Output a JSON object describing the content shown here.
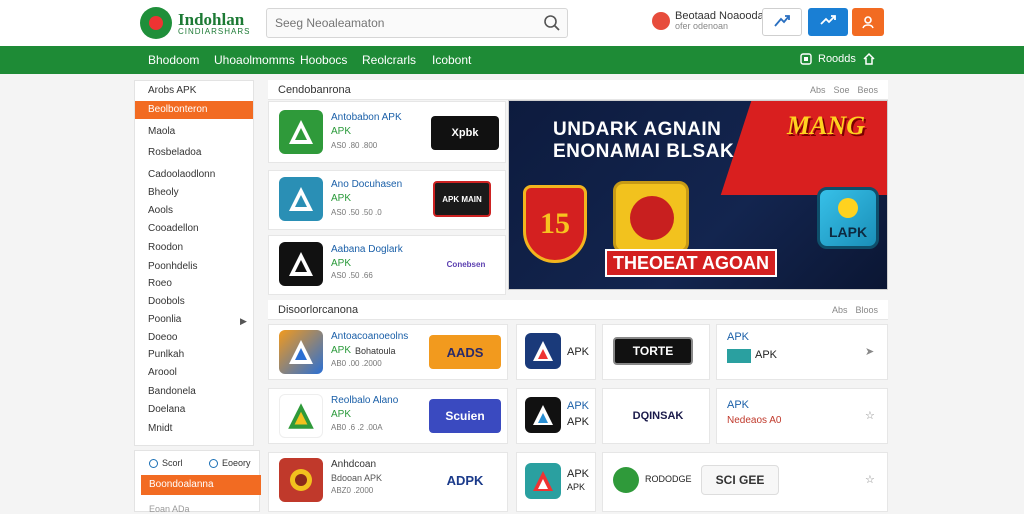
{
  "header": {
    "logo_title": "Indohlan",
    "logo_sub": "CINDIARSHARS",
    "search_placeholder": "Seeg Neoaleamaton",
    "account_name": "Beotaad Noaoodar",
    "account_sub": "ofer odenoan"
  },
  "nav": {
    "items": [
      "Bhodoom",
      "Uhoaolmomms",
      "Hoobocs",
      "Reolcrarls",
      "Icobont"
    ],
    "right_label": "Roodds"
  },
  "sidebar": {
    "items": [
      "Arobs APK",
      "Beolbonteron",
      "Maola",
      "Rosbeladoa",
      "Cadoolaodlonn",
      "Bheoly",
      "Aools",
      "Cooadellon",
      "Roodon",
      "Poonhdelis",
      "Roeo",
      "Doobols",
      "Poonlia",
      "Doeoo",
      "Punlkah",
      "Aroool",
      "Bandonela",
      "Doelana",
      "Mnidt"
    ],
    "active_index": 1,
    "radio_a": "Scorl",
    "radio_b": "Eoeory",
    "cta": "Boondoalanna",
    "footer": "Eoan ADa"
  },
  "section1": {
    "title": "Cendobanrona",
    "tools": [
      "Abs",
      "Soe",
      "Beos"
    ],
    "apps": [
      {
        "name": "Antobabon APK",
        "type": "APK",
        "meta": "AS0 .80 .800",
        "ad": "Xpbk"
      },
      {
        "name": "Ano Docuhasen",
        "type": "APK",
        "meta": "AS0 .50 .50 .0",
        "ad": "APK MAIN"
      },
      {
        "name": "Aabana Doglark",
        "type": "APK",
        "meta": "AS0 .50 .66",
        "ad": "Conebsen"
      }
    ]
  },
  "banner": {
    "headline_1": "UNDARK AGNAIN",
    "headline_2": "ENONAMAI BLSAK",
    "promo": "MANG",
    "shield_number": "15",
    "cta": "THEOEAT AGOAN",
    "badge": "LAPK"
  },
  "section2": {
    "title": "Disoorlorcanona",
    "tools": [
      "Abs",
      "Bloos"
    ],
    "apps": [
      {
        "name": "Antoacoanoeolns",
        "type": "APK",
        "extra": "Bohatoula",
        "meta": "AB0 .00 .2000",
        "ad": "AADS"
      },
      {
        "name": "Reolbalo Alano",
        "type": "APK",
        "meta": "AB0 .6 .2 .00A",
        "ad": "Scuien"
      },
      {
        "name": "Anhdcoan",
        "type": "Bdooan APK",
        "meta": "ABZ0 .2000",
        "ad": "ADPK"
      }
    ],
    "tiles": [
      {
        "label": "APK",
        "brand": "TORTE",
        "side_top": "APK",
        "side_bottom": "APK"
      },
      {
        "label": "APK",
        "label2": "APK",
        "brand": "DQINSAK",
        "side_top": "APK",
        "side_bottom": "Nedeaos A0"
      },
      {
        "label": "APK",
        "label2": "APK",
        "brand": "RODODGE",
        "brand2": "SCI GEE"
      }
    ]
  },
  "colors": {
    "brand_green": "#1e8b36",
    "accent_orange": "#f26b22",
    "accent_blue": "#1a7fd4"
  }
}
